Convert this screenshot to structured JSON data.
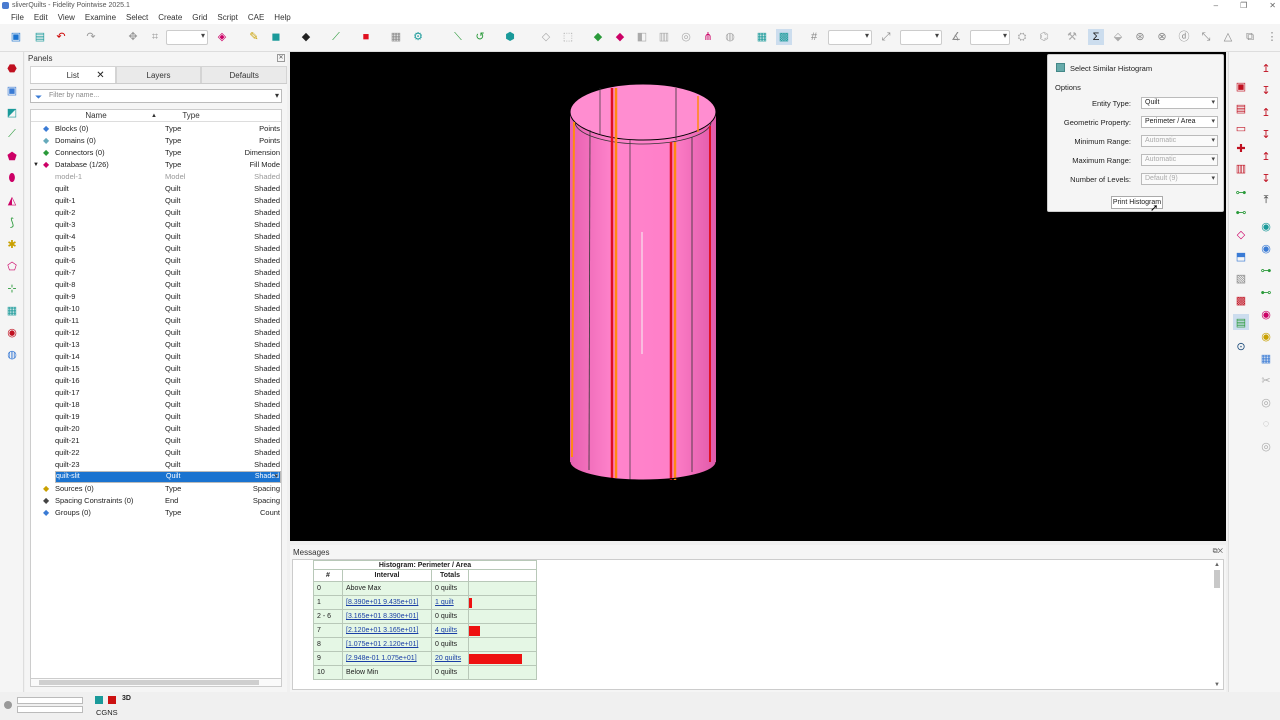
{
  "window": {
    "title": "sliverQuilts - Fidelity Pointwise 2025.1"
  },
  "menu": [
    "File",
    "Edit",
    "View",
    "Examine",
    "Select",
    "Create",
    "Grid",
    "Script",
    "CAE",
    "Help"
  ],
  "panels": {
    "title": "Panels",
    "tabs": [
      "List",
      "Layers",
      "Defaults"
    ],
    "filter_placeholder": "Filter by name...",
    "columns": {
      "name": "Name",
      "type": "Type"
    },
    "rows": [
      {
        "name": "Blocks (0)",
        "type": "Type",
        "mode": "Points",
        "icon": "block-icon",
        "color": "#3a7bd5",
        "indent": 0,
        "style": "normal"
      },
      {
        "name": "Domains (0)",
        "type": "Type",
        "mode": "Points",
        "icon": "domain-icon",
        "color": "#6ab",
        "indent": 0,
        "style": "normal"
      },
      {
        "name": "Connectors (0)",
        "type": "Type",
        "mode": "Dimension",
        "icon": "connector-icon",
        "color": "#2a9a3a",
        "indent": 0,
        "style": "normal"
      },
      {
        "name": "Database (1/26)",
        "type": "Type",
        "mode": "Fill Mode",
        "icon": "database-icon",
        "color": "#c06",
        "indent": 0,
        "style": "expanded"
      },
      {
        "name": "model-1",
        "type": "Model",
        "mode": "Shaded",
        "indent": 1,
        "style": "grey"
      },
      {
        "name": "quilt",
        "type": "Quilt",
        "mode": "Shaded",
        "indent": 1,
        "style": "normal"
      },
      {
        "name": "quilt-1",
        "type": "Quilt",
        "mode": "Shaded",
        "indent": 1,
        "style": "normal"
      },
      {
        "name": "quilt-2",
        "type": "Quilt",
        "mode": "Shaded",
        "indent": 1,
        "style": "normal"
      },
      {
        "name": "quilt-3",
        "type": "Quilt",
        "mode": "Shaded",
        "indent": 1,
        "style": "normal"
      },
      {
        "name": "quilt-4",
        "type": "Quilt",
        "mode": "Shaded",
        "indent": 1,
        "style": "normal"
      },
      {
        "name": "quilt-5",
        "type": "Quilt",
        "mode": "Shaded",
        "indent": 1,
        "style": "normal"
      },
      {
        "name": "quilt-6",
        "type": "Quilt",
        "mode": "Shaded",
        "indent": 1,
        "style": "normal"
      },
      {
        "name": "quilt-7",
        "type": "Quilt",
        "mode": "Shaded",
        "indent": 1,
        "style": "normal"
      },
      {
        "name": "quilt-8",
        "type": "Quilt",
        "mode": "Shaded",
        "indent": 1,
        "style": "normal"
      },
      {
        "name": "quilt-9",
        "type": "Quilt",
        "mode": "Shaded",
        "indent": 1,
        "style": "normal"
      },
      {
        "name": "quilt-10",
        "type": "Quilt",
        "mode": "Shaded",
        "indent": 1,
        "style": "normal"
      },
      {
        "name": "quilt-11",
        "type": "Quilt",
        "mode": "Shaded",
        "indent": 1,
        "style": "normal"
      },
      {
        "name": "quilt-12",
        "type": "Quilt",
        "mode": "Shaded",
        "indent": 1,
        "style": "normal"
      },
      {
        "name": "quilt-13",
        "type": "Quilt",
        "mode": "Shaded",
        "indent": 1,
        "style": "normal"
      },
      {
        "name": "quilt-14",
        "type": "Quilt",
        "mode": "Shaded",
        "indent": 1,
        "style": "normal"
      },
      {
        "name": "quilt-15",
        "type": "Quilt",
        "mode": "Shaded",
        "indent": 1,
        "style": "normal"
      },
      {
        "name": "quilt-16",
        "type": "Quilt",
        "mode": "Shaded",
        "indent": 1,
        "style": "normal"
      },
      {
        "name": "quilt-17",
        "type": "Quilt",
        "mode": "Shaded",
        "indent": 1,
        "style": "normal"
      },
      {
        "name": "quilt-18",
        "type": "Quilt",
        "mode": "Shaded",
        "indent": 1,
        "style": "normal"
      },
      {
        "name": "quilt-19",
        "type": "Quilt",
        "mode": "Shaded",
        "indent": 1,
        "style": "normal"
      },
      {
        "name": "quilt-20",
        "type": "Quilt",
        "mode": "Shaded",
        "indent": 1,
        "style": "normal"
      },
      {
        "name": "quilt-21",
        "type": "Quilt",
        "mode": "Shaded",
        "indent": 1,
        "style": "normal"
      },
      {
        "name": "quilt-22",
        "type": "Quilt",
        "mode": "Shaded",
        "indent": 1,
        "style": "normal"
      },
      {
        "name": "quilt-23",
        "type": "Quilt",
        "mode": "Shaded",
        "indent": 1,
        "style": "normal"
      },
      {
        "name": "quilt-slit",
        "type": "Quilt",
        "mode": "Shaded",
        "indent": 1,
        "style": "selected"
      },
      {
        "name": "Sources (0)",
        "type": "Type",
        "mode": "Spacing",
        "icon": "source-icon",
        "color": "#c9a000",
        "indent": 0,
        "style": "normal"
      },
      {
        "name": "Spacing Constraints (0)",
        "type": "End",
        "mode": "Spacing",
        "icon": "spacing-icon",
        "color": "#444",
        "indent": 0,
        "style": "normal"
      },
      {
        "name": "Groups (0)",
        "type": "Type",
        "mode": "Count",
        "icon": "group-icon",
        "color": "#3a7bd5",
        "indent": 0,
        "style": "normal"
      }
    ]
  },
  "histogram_panel": {
    "title": "Select Similar Histogram",
    "options_label": "Options",
    "fields": [
      {
        "label": "Entity Type:",
        "value": "Quilt",
        "disabled": false
      },
      {
        "label": "Geometric Property:",
        "value": "Perimeter / Area",
        "disabled": false
      },
      {
        "label": "Minimum Range:",
        "value": "Automatic",
        "disabled": true
      },
      {
        "label": "Maximum Range:",
        "value": "Automatic",
        "disabled": true
      },
      {
        "label": "Number of Levels:",
        "value": "Default (9)",
        "disabled": true
      }
    ],
    "print_button": "Print Histogram"
  },
  "messages": {
    "title": "Messages",
    "histogram": {
      "caption": "Histogram: Perimeter / Area",
      "headers": [
        "#",
        "Interval",
        "Totals"
      ],
      "bar_color": "#ee1111",
      "rows": [
        {
          "num": "0",
          "interval": "Above Max",
          "interval_link": false,
          "totals": "0 quilts",
          "totals_link": false,
          "count": 0
        },
        {
          "num": "1",
          "interval": "[8.390e+01 9.435e+01]",
          "interval_link": true,
          "totals": "1 quilt",
          "totals_link": true,
          "count": 1
        },
        {
          "num": "2 - 6",
          "interval": "[3.165e+01 8.390e+01]",
          "interval_link": true,
          "totals": "0 quilts",
          "totals_link": false,
          "count": 0
        },
        {
          "num": "7",
          "interval": "[2.120e+01 3.165e+01]",
          "interval_link": true,
          "totals": "4 quilts",
          "totals_link": true,
          "count": 4
        },
        {
          "num": "8",
          "interval": "[1.075e+01 2.120e+01]",
          "interval_link": true,
          "totals": "0 quilts",
          "totals_link": false,
          "count": 0
        },
        {
          "num": "9",
          "interval": "[2.948e-01 1.075e+01]",
          "interval_link": true,
          "totals": "20 quilts",
          "totals_link": true,
          "count": 20
        },
        {
          "num": "10",
          "interval": "Below Min",
          "interval_link": false,
          "totals": "0 quilts",
          "totals_link": false,
          "count": 0
        }
      ]
    }
  },
  "status": {
    "view_mode": "3D",
    "solver": "CGNS"
  },
  "colors": {
    "accent": "#1a73d0",
    "viewport_bg": "#000000",
    "cylinder": "#ff7fc8",
    "stripe_red": "#e01020",
    "stripe_orange": "#ff8a10"
  }
}
